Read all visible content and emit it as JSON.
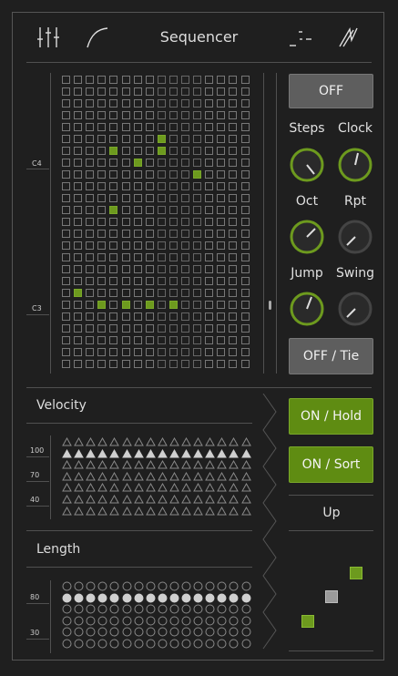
{
  "header": {
    "title": "Sequencer"
  },
  "sequencer": {
    "note_labels": [
      "C4",
      "C3"
    ],
    "active_cells": [
      [
        5,
        8
      ],
      [
        6,
        4
      ],
      [
        6,
        8
      ],
      [
        7,
        6
      ],
      [
        8,
        11
      ],
      [
        11,
        4
      ],
      [
        18,
        1
      ],
      [
        19,
        3
      ],
      [
        19,
        5
      ],
      [
        19,
        7
      ],
      [
        19,
        9
      ]
    ]
  },
  "controls": {
    "top_button": "OFF",
    "knobs": [
      {
        "label": "Steps"
      },
      {
        "label": "Clock"
      },
      {
        "label": "Oct"
      },
      {
        "label": "Rpt"
      },
      {
        "label": "Jump"
      },
      {
        "label": "Swing"
      }
    ],
    "tie_button": "OFF / Tie",
    "hold_button": "ON / Hold",
    "sort_button": "ON / Sort",
    "direction": "Up"
  },
  "velocity": {
    "label": "Velocity",
    "scale": [
      "100",
      "70",
      "40"
    ],
    "level": 100
  },
  "length": {
    "label": "Length",
    "scale": [
      "80",
      "30"
    ],
    "level": 80
  },
  "colors": {
    "accent": "#6d9a1e",
    "button_gray": "#5e5e5e",
    "background": "#1f1f1f"
  }
}
